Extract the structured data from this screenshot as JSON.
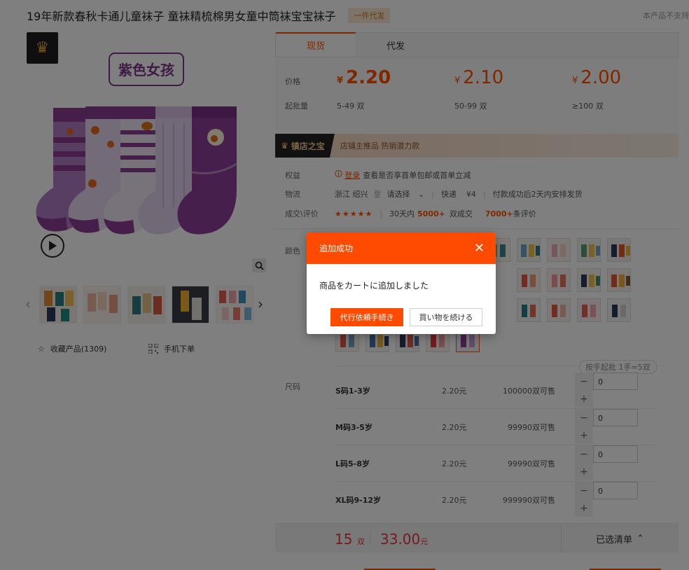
{
  "product": {
    "title": "19年新款春秋卡通儿童袜子 童袜精梳棉男女童中筒袜宝宝袜子",
    "badge": "一件代发",
    "not_support": "本产品不支持",
    "image_label": "紫色女孩"
  },
  "left": {
    "favorite": "收藏产品(1309)",
    "mobile_order": "手机下单"
  },
  "tabs": [
    "现货",
    "代发"
  ],
  "price": {
    "label": "价格",
    "moq_label": "起批量",
    "currency": "¥",
    "tiers": [
      {
        "price": "2.20",
        "qty": "5-49 双"
      },
      {
        "price": "2.10",
        "qty": "50-99 双"
      },
      {
        "price": "2.00",
        "qty": "≥100 双"
      }
    ]
  },
  "shop_banner": {
    "name": "镇店之宝",
    "tags": "店铺主推品   热销潜力款"
  },
  "info": {
    "rights_label": "权益",
    "login": "登录",
    "rights_text": "查看是否享首单包邮或首单立减",
    "logistics_label": "物流",
    "from": "浙江 绍兴",
    "to_word": "至",
    "select_dest": "请选择",
    "express": "快递",
    "fee": "¥4",
    "ship_note": "付款成功后2天内安排发货",
    "deal_label": "成交\\评价",
    "stars": "★★★★★",
    "days30_prefix": "30天内",
    "sold": "5000+",
    "sold_suffix": "双成交",
    "reviews": "7000+",
    "reviews_suffix": "条评价"
  },
  "sku": {
    "color_label": "颜色",
    "size_label": "尺码",
    "batch_note": "按手起批 1手=5双",
    "sizes": [
      {
        "name": "S码1-3岁",
        "price": "2.20元",
        "stock": "100000双可售",
        "qty": "0"
      },
      {
        "name": "M码3-5岁",
        "price": "2.20元",
        "stock": "99990双可售",
        "qty": "0"
      },
      {
        "name": "L码5-8岁",
        "price": "2.20元",
        "stock": "99990双可售",
        "qty": "0"
      },
      {
        "name": "XL码9-12岁",
        "price": "2.20元",
        "stock": "999990双可售",
        "qty": "0"
      }
    ]
  },
  "summary": {
    "qty": "15",
    "qty_unit": "双",
    "total": "33.00",
    "total_unit": "元",
    "selected_list": "已选清单"
  },
  "modal": {
    "title": "追加成功",
    "message": "商品をカートに追加しました",
    "primary": "代行依頼手続き",
    "secondary": "買い物を続ける"
  },
  "colors": {
    "accent": "#ff5000",
    "modal_accent": "#ff4a00",
    "price_red": "#e4393c"
  }
}
